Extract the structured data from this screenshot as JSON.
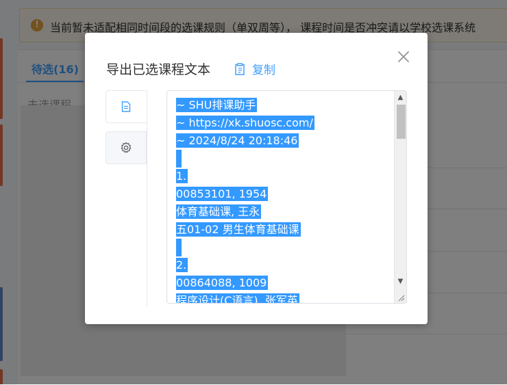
{
  "background": {
    "warning_text": "当前暂未适配相同时间段的选课规则（单双周等）， 课程时间是否冲突请以学校选课系统",
    "tab_pending": "待选(16)",
    "unselected_label": "未选课程"
  },
  "modal": {
    "title": "导出已选课程文本",
    "copy_label": "复制",
    "textarea_lines": [
      "~ SHU排课助手",
      "~ https://xk.shuosc.com/",
      "~ 2024/8/24 20:18:46",
      "",
      "1.",
      "00853101, 1954",
      "体育基础课, 王永",
      "五01-02 男生体育基础课",
      "",
      "2.",
      "00864088, 1009",
      "程序设计(C语言), 张军英"
    ]
  },
  "icons": {
    "warning": "warning-circle-icon",
    "copy": "clipboard-icon",
    "close": "close-icon",
    "text_tab": "document-icon",
    "settings_tab": "gear-icon"
  },
  "colors": {
    "accent": "#409eff",
    "selection": "#3399ff",
    "warning": "#e6a23c"
  }
}
